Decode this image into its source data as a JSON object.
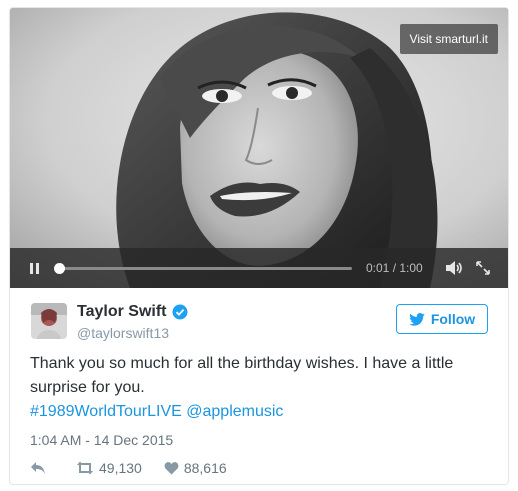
{
  "video": {
    "visit_label": "Visit smarturl.it",
    "time": "0:01 / 1:00",
    "progress": 0.01
  },
  "tweet": {
    "name": "Taylor Swift",
    "handle": "@taylorswift13",
    "follow_label": "Follow",
    "text": "Thank you so much for all the birthday wishes. I have a little surprise for you.",
    "hashtag": "#1989WorldTourLIVE",
    "mention": "@applemusic",
    "timestamp": "1:04 AM - 14 Dec 2015",
    "retweets": "49,130",
    "likes": "88,616"
  },
  "colors": {
    "accent": "#1da1f2",
    "link": "#1b95e0",
    "verified": "#1da1f2"
  },
  "icons": [
    "pause-icon",
    "volume-icon",
    "fullscreen-icon",
    "verified-icon",
    "twitter-bird-icon",
    "reply-icon",
    "retweet-icon",
    "heart-icon"
  ]
}
